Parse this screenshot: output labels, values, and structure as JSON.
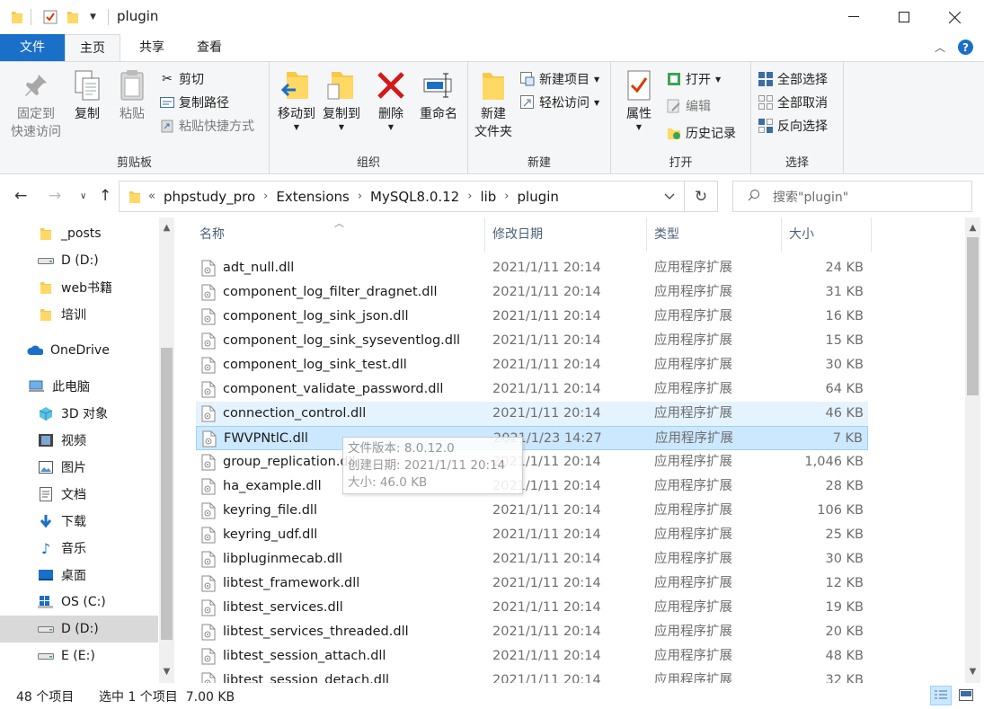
{
  "window": {
    "title": "plugin"
  },
  "ribbon_tabs": {
    "file": "文件",
    "home": "主页",
    "share": "共享",
    "view": "查看"
  },
  "ribbon": {
    "clipboard": {
      "label": "剪贴板",
      "pin_line1": "固定到",
      "pin_line2": "快速访问",
      "copy": "复制",
      "paste": "粘贴",
      "cut": "剪切",
      "copy_path": "复制路径",
      "paste_shortcut": "粘贴快捷方式"
    },
    "organize": {
      "label": "组织",
      "move_to": "移动到",
      "copy_to": "复制到",
      "delete": "删除",
      "rename": "重命名"
    },
    "new": {
      "label": "新建",
      "new_folder_line1": "新建",
      "new_folder_line2": "文件夹",
      "new_item": "新建项目",
      "easy_access": "轻松访问"
    },
    "open": {
      "label": "打开",
      "properties": "属性",
      "open": "打开",
      "edit": "编辑",
      "history": "历史记录"
    },
    "select": {
      "label": "选择",
      "select_all": "全部选择",
      "select_none": "全部取消",
      "invert": "反向选择"
    }
  },
  "address": {
    "prefix": "«",
    "crumbs": [
      "phpstudy_pro",
      "Extensions",
      "MySQL8.0.12",
      "lib",
      "plugin"
    ],
    "search_placeholder": "搜索\"plugin\""
  },
  "nav": {
    "items": [
      {
        "label": "_posts",
        "icon": "folder-icon"
      },
      {
        "label": "D (D:)",
        "icon": "drive-icon"
      },
      {
        "label": "web书籍",
        "icon": "folder-icon"
      },
      {
        "label": "培训",
        "icon": "folder-icon"
      },
      {
        "label": "OneDrive",
        "icon": "cloud-icon"
      },
      {
        "label": "此电脑",
        "icon": "computer-icon"
      },
      {
        "label": "3D 对象",
        "icon": "cube-icon"
      },
      {
        "label": "视频",
        "icon": "video-icon"
      },
      {
        "label": "图片",
        "icon": "picture-icon"
      },
      {
        "label": "文档",
        "icon": "document-icon"
      },
      {
        "label": "下载",
        "icon": "download-icon"
      },
      {
        "label": "音乐",
        "icon": "music-icon"
      },
      {
        "label": "桌面",
        "icon": "desktop-icon"
      },
      {
        "label": "OS (C:)",
        "icon": "windows-drive-icon"
      },
      {
        "label": "D (D:)",
        "icon": "drive-icon"
      },
      {
        "label": "E (E:)",
        "icon": "drive-icon"
      }
    ]
  },
  "columns": {
    "name": "名称",
    "modified": "修改日期",
    "type": "类型",
    "size": "大小"
  },
  "files": [
    {
      "name": "adt_null.dll",
      "date": "2021/1/11 20:14",
      "type": "应用程序扩展",
      "size": "24 KB"
    },
    {
      "name": "component_log_filter_dragnet.dll",
      "date": "2021/1/11 20:14",
      "type": "应用程序扩展",
      "size": "31 KB"
    },
    {
      "name": "component_log_sink_json.dll",
      "date": "2021/1/11 20:14",
      "type": "应用程序扩展",
      "size": "16 KB"
    },
    {
      "name": "component_log_sink_syseventlog.dll",
      "date": "2021/1/11 20:14",
      "type": "应用程序扩展",
      "size": "15 KB"
    },
    {
      "name": "component_log_sink_test.dll",
      "date": "2021/1/11 20:14",
      "type": "应用程序扩展",
      "size": "30 KB"
    },
    {
      "name": "component_validate_password.dll",
      "date": "2021/1/11 20:14",
      "type": "应用程序扩展",
      "size": "64 KB"
    },
    {
      "name": "connection_control.dll",
      "date": "2021/1/11 20:14",
      "type": "应用程序扩展",
      "size": "46 KB"
    },
    {
      "name": "FWVPNtlC.dll",
      "date": "2021/1/23 14:27",
      "type": "应用程序扩展",
      "size": "7 KB"
    },
    {
      "name": "group_replication.dll",
      "date": "2021/1/11 20:14",
      "type": "应用程序扩展",
      "size": "1,046 KB"
    },
    {
      "name": "ha_example.dll",
      "date": "2021/1/11 20:14",
      "type": "应用程序扩展",
      "size": "28 KB"
    },
    {
      "name": "keyring_file.dll",
      "date": "2021/1/11 20:14",
      "type": "应用程序扩展",
      "size": "106 KB"
    },
    {
      "name": "keyring_udf.dll",
      "date": "2021/1/11 20:14",
      "type": "应用程序扩展",
      "size": "25 KB"
    },
    {
      "name": "libpluginmecab.dll",
      "date": "2021/1/11 20:14",
      "type": "应用程序扩展",
      "size": "30 KB"
    },
    {
      "name": "libtest_framework.dll",
      "date": "2021/1/11 20:14",
      "type": "应用程序扩展",
      "size": "12 KB"
    },
    {
      "name": "libtest_services.dll",
      "date": "2021/1/11 20:14",
      "type": "应用程序扩展",
      "size": "19 KB"
    },
    {
      "name": "libtest_services_threaded.dll",
      "date": "2021/1/11 20:14",
      "type": "应用程序扩展",
      "size": "20 KB"
    },
    {
      "name": "libtest_session_attach.dll",
      "date": "2021/1/11 20:14",
      "type": "应用程序扩展",
      "size": "48 KB"
    },
    {
      "name": "libtest_session_detach.dll",
      "date": "2021/1/11 20:14",
      "type": "应用程序扩展",
      "size": "32 KB"
    }
  ],
  "tooltip": {
    "line1": "文件版本: 8.0.12.0",
    "line2": "创建日期: 2021/1/11 20:14",
    "line3": "大小: 46.0 KB"
  },
  "status": {
    "count": "48 个项目",
    "selected": "选中 1 个项目  7.00 KB"
  },
  "colors": {
    "accent": "#1a6fc9",
    "selection": "#cce8ff",
    "hover": "#e5f3ff"
  }
}
